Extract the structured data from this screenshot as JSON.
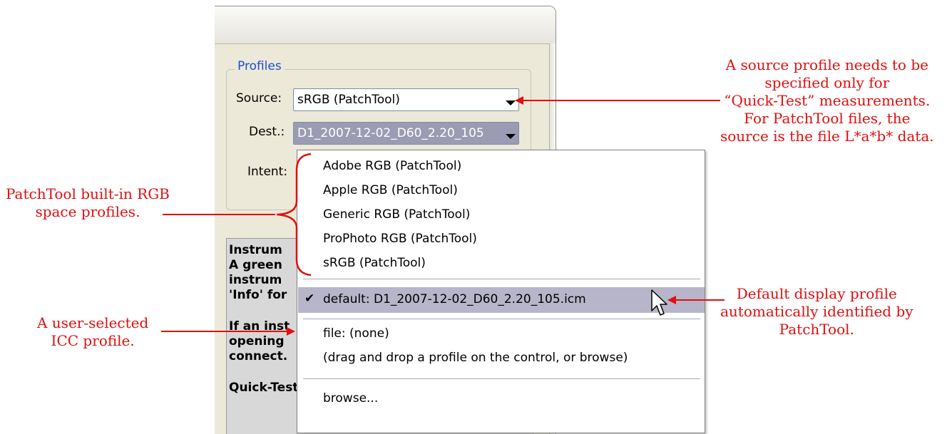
{
  "profiles": {
    "group_title": "Profiles",
    "source_label": "Source:",
    "source_value": "sRGB (PatchTool)",
    "dest_label": "Dest.:",
    "dest_value": "D1_2007-12-02_D60_2.20_105",
    "intent_label": "Intent:"
  },
  "info_panel": {
    "lines": [
      "Instrum",
      "A green",
      "instrum",
      "'Info' for",
      "",
      "If an inst",
      "opening",
      "connect.",
      "",
      "Quick-Test:"
    ]
  },
  "dropdown": {
    "builtin_items": [
      "Adobe RGB (PatchTool)",
      "Apple RGB (PatchTool)",
      "Generic RGB (PatchTool)",
      "ProPhoto RGB (PatchTool)",
      "sRGB (PatchTool)"
    ],
    "check_mark": "✔",
    "default_item": "default: D1_2007-12-02_D60_2.20_105.icm",
    "file_item": "file: (none)",
    "file_hint": "(drag and drop a profile on the control, or browse)",
    "browse_item": "browse..."
  },
  "annotations": {
    "source_note": [
      "A source profile needs to be",
      "specified only for",
      "“Quick-Test” measurements.",
      "For PatchTool files, the",
      "source is the file L*a*b* data."
    ],
    "builtin_note": [
      "PatchTool built-in RGB",
      "space profiles."
    ],
    "user_note": [
      "A user-selected",
      "ICC profile."
    ],
    "default_note": [
      "Default display profile",
      "automatically identified by",
      "PatchTool."
    ]
  },
  "colors": {
    "annotation": "#e10f0f",
    "group_title": "#1c4fcf",
    "highlight": "#b7b5c9"
  }
}
